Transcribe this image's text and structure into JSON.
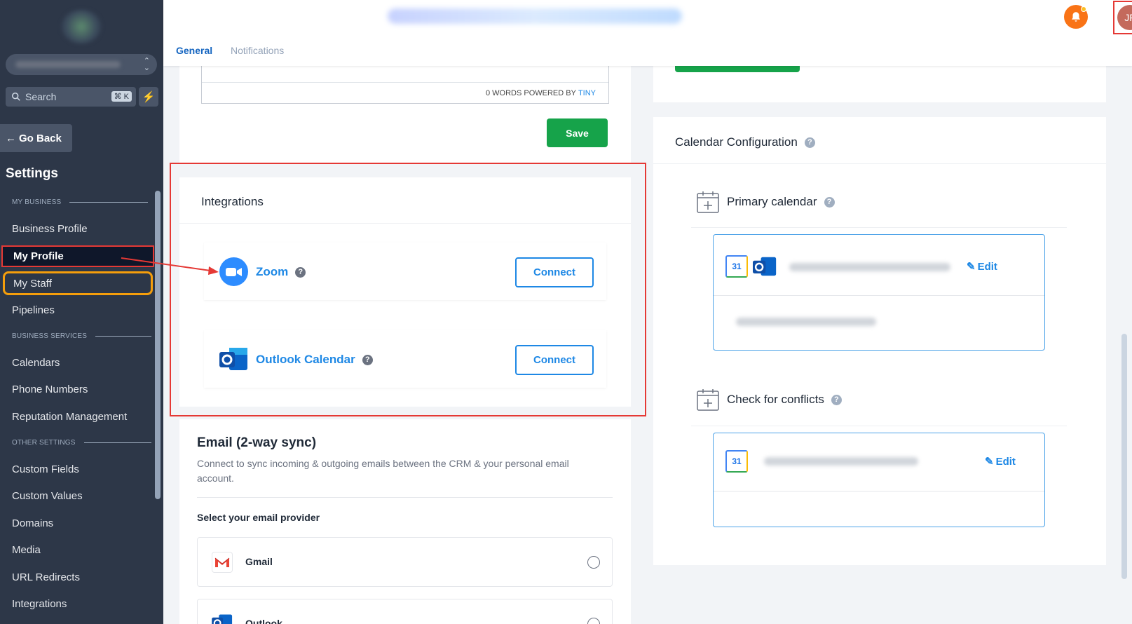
{
  "sidebar": {
    "search_label": "Search",
    "search_shortcut": "⌘ K",
    "back_label": "Go Back",
    "title": "Settings",
    "sections": {
      "my_business": "MY BUSINESS",
      "business_services": "BUSINESS SERVICES",
      "other_settings": "OTHER SETTINGS"
    },
    "items": {
      "business_profile": "Business Profile",
      "my_profile": "My Profile",
      "my_staff": "My Staff",
      "pipelines": "Pipelines",
      "calendars": "Calendars",
      "phone_numbers": "Phone Numbers",
      "reputation_management": "Reputation Management",
      "custom_fields": "Custom Fields",
      "custom_values": "Custom Values",
      "domains": "Domains",
      "media": "Media",
      "url_redirects": "URL Redirects",
      "integrations": "Integrations"
    }
  },
  "header": {
    "tabs": {
      "general": "General",
      "notifications": "Notifications"
    },
    "avatar_initials": "JF"
  },
  "editor": {
    "footer_words": "0 WORDS POWERED BY",
    "footer_brand": "TINY",
    "save_label": "Save"
  },
  "integrations": {
    "title": "Integrations",
    "zoom": {
      "name": "Zoom",
      "button": "Connect"
    },
    "outlook": {
      "name": "Outlook Calendar",
      "button": "Connect"
    }
  },
  "email": {
    "title": "Email (2-way sync)",
    "description": "Connect to sync incoming & outgoing emails between the CRM & your personal email account.",
    "select_label": "Select your email provider",
    "providers": {
      "gmail": "Gmail",
      "outlook": "Outlook"
    }
  },
  "calendar": {
    "title": "Calendar Configuration",
    "primary_label": "Primary calendar",
    "conflicts_label": "Check for conflicts",
    "edit_label": "Edit",
    "gcal_day": "31"
  },
  "colors": {
    "sidebar_bg": "#2d3748",
    "accent_blue": "#1e88e5",
    "save_green": "#16a34a",
    "annotation_red": "#e53935",
    "annotation_orange": "#f59e0b",
    "bell_orange": "#f97316"
  }
}
